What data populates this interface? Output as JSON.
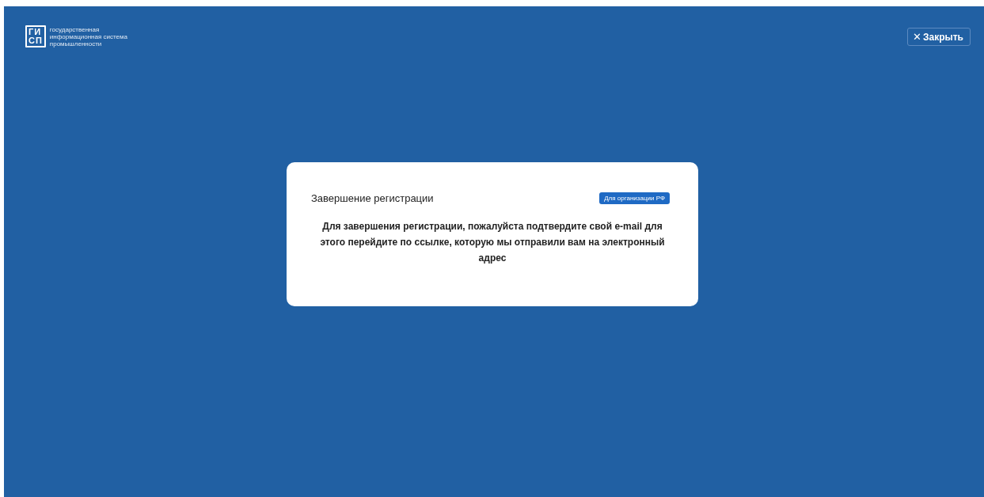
{
  "logo": {
    "mark_top": "ГИ",
    "mark_bottom": "СП",
    "lines": [
      "государственная",
      "информационная система",
      "промышленности"
    ]
  },
  "close_button": {
    "icon": "✕",
    "label": "Закрыть"
  },
  "dialog": {
    "title": "Завершение регистрации",
    "badge": "Для организации РФ",
    "message": "Для завершения регистрации, пожалуйста подтвердите свой e-mail для этого перейдите по ссылке, которую мы отправили вам на электронный адрес"
  }
}
